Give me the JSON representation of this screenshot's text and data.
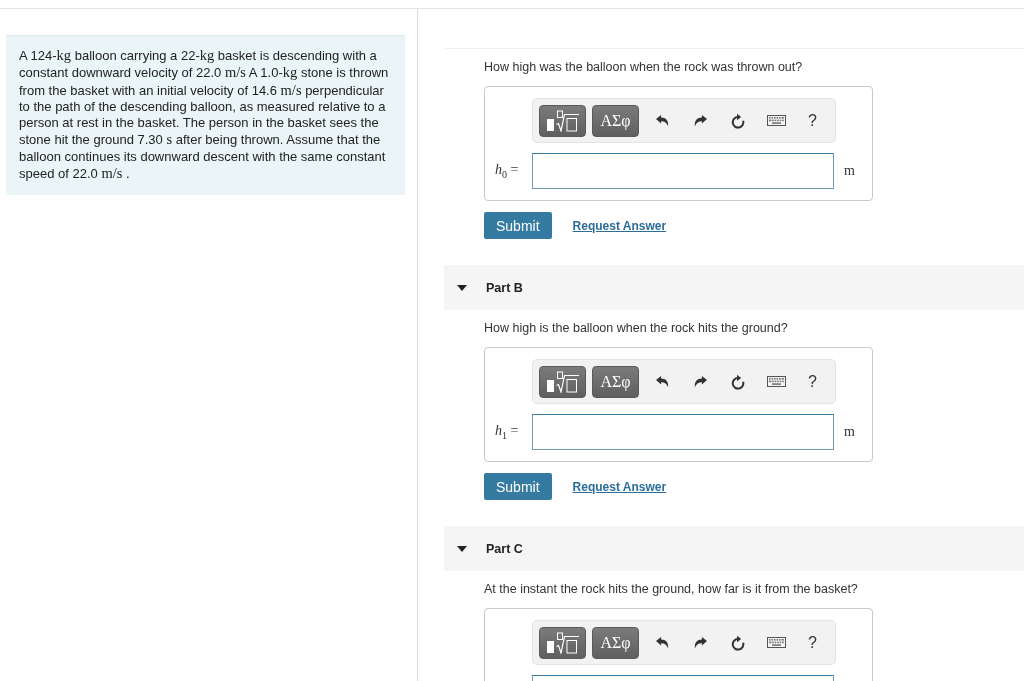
{
  "problem": {
    "segments": [
      {
        "kind": "text",
        "text": "A 124-"
      },
      {
        "kind": "math",
        "text": "kg"
      },
      {
        "kind": "text",
        "text": " balloon carrying a 22-"
      },
      {
        "kind": "math",
        "text": "kg"
      },
      {
        "kind": "text",
        "text": " basket is descending with a constant downward velocity of 22.0 "
      },
      {
        "kind": "math",
        "text": "m/s"
      },
      {
        "kind": "text",
        "text": " A 1.0-"
      },
      {
        "kind": "math",
        "text": "kg"
      },
      {
        "kind": "text",
        "text": " stone is thrown from the basket with an initial velocity of 14.6 "
      },
      {
        "kind": "math",
        "text": "m/s"
      },
      {
        "kind": "text",
        "text": " perpendicular to the path of the descending balloon, as measured relative to a person at rest in the basket. The person in the basket sees the stone hit the ground 7.30 "
      },
      {
        "kind": "math",
        "text": "s"
      },
      {
        "kind": "text",
        "text": " after being thrown. Assume that the balloon continues its downward descent with the same constant speed of 22.0 "
      },
      {
        "kind": "math",
        "text": "m/s"
      },
      {
        "kind": "text",
        "text": " ."
      }
    ]
  },
  "parts": [
    {
      "question": "How high was the balloon when the rock was thrown out?",
      "toolbar": {
        "symbols": "ΑΣφ",
        "help": "?"
      },
      "answer": {
        "label": "*h*$_{0}$ =",
        "unit": "m"
      },
      "actions": {
        "submit": "Submit",
        "request": "Request Answer"
      }
    },
    {
      "title": "Part B",
      "expanded": true,
      "question": "How high is the balloon when the rock hits the ground?",
      "toolbar": {
        "symbols": "ΑΣφ",
        "help": "?"
      },
      "answer": {
        "label": "*h*$_{1}$ =",
        "unit": "m"
      },
      "actions": {
        "submit": "Submit",
        "request": "Request Answer"
      }
    },
    {
      "title": "Part C",
      "expanded": true,
      "question": "At the instant the rock hits the ground, how far is it from the basket?",
      "toolbar": {
        "symbols": "ΑΣφ",
        "help": "?"
      }
    }
  ]
}
